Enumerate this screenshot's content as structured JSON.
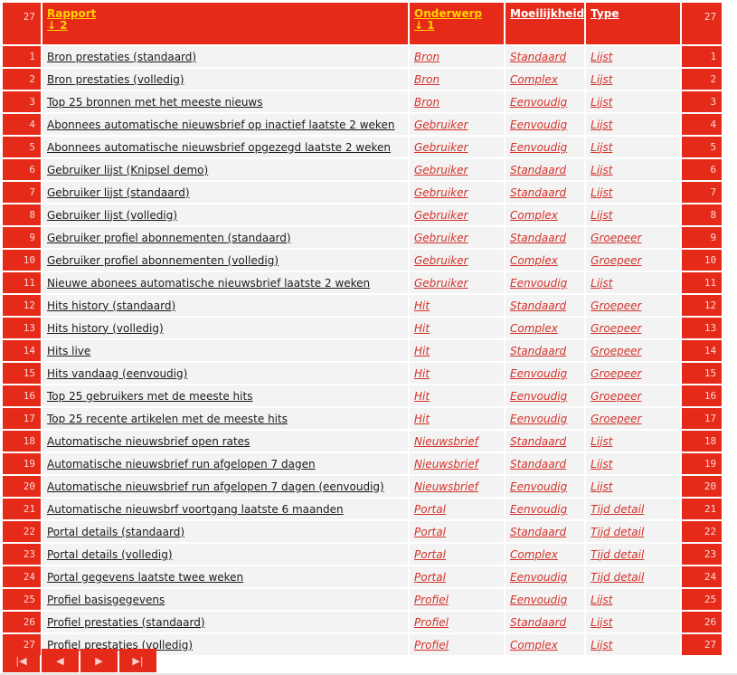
{
  "header": {
    "count_left": "27",
    "count_right": "27",
    "columns": {
      "rapport": {
        "label": "Rapport",
        "sort": "↓ 2"
      },
      "onderwerp": {
        "label": "Onderwerp",
        "sort": "↓ 1"
      },
      "moeilijkheid": {
        "label": "Moeilijkheid"
      },
      "type": {
        "label": "Type"
      }
    }
  },
  "colors": {
    "accent_red": "#e52a1a",
    "sorted_header_yellow": "#ffd200",
    "tag_link_red": "#d2322a",
    "row_bg": "#f3f3f3"
  },
  "rows": [
    {
      "n": "1",
      "rapport": "Bron prestaties (standaard)",
      "onderwerp": "Bron",
      "moeilijkheid": "Standaard",
      "type": "Lijst"
    },
    {
      "n": "2",
      "rapport": "Bron prestaties (volledig)",
      "onderwerp": "Bron",
      "moeilijkheid": "Complex",
      "type": "Lijst"
    },
    {
      "n": "3",
      "rapport": "Top 25 bronnen met het meeste nieuws",
      "onderwerp": "Bron",
      "moeilijkheid": "Eenvoudig",
      "type": "Lijst"
    },
    {
      "n": "4",
      "rapport": "Abonnees automatische nieuwsbrief op inactief laatste 2 weken",
      "onderwerp": "Gebruiker",
      "moeilijkheid": "Eenvoudig",
      "type": "Lijst"
    },
    {
      "n": "5",
      "rapport": "Abonnees automatische nieuwsbrief opgezegd laatste 2 weken",
      "onderwerp": "Gebruiker",
      "moeilijkheid": "Eenvoudig",
      "type": "Lijst"
    },
    {
      "n": "6",
      "rapport": "Gebruiker lijst (Knipsel demo)",
      "onderwerp": "Gebruiker",
      "moeilijkheid": "Standaard",
      "type": "Lijst"
    },
    {
      "n": "7",
      "rapport": "Gebruiker lijst (standaard)",
      "onderwerp": "Gebruiker",
      "moeilijkheid": "Standaard",
      "type": "Lijst"
    },
    {
      "n": "8",
      "rapport": "Gebruiker lijst (volledig)",
      "onderwerp": "Gebruiker",
      "moeilijkheid": "Complex",
      "type": "Lijst"
    },
    {
      "n": "9",
      "rapport": "Gebruiker profiel abonnementen (standaard)",
      "onderwerp": "Gebruiker",
      "moeilijkheid": "Standaard",
      "type": "Groepeer"
    },
    {
      "n": "10",
      "rapport": "Gebruiker profiel abonnementen (volledig)",
      "onderwerp": "Gebruiker",
      "moeilijkheid": "Complex",
      "type": "Groepeer"
    },
    {
      "n": "11",
      "rapport": "Nieuwe abonees automatische nieuwsbrief laatste 2 weken",
      "onderwerp": "Gebruiker",
      "moeilijkheid": "Eenvoudig",
      "type": "Lijst"
    },
    {
      "n": "12",
      "rapport": "Hits history (standaard)",
      "onderwerp": "Hit",
      "moeilijkheid": "Standaard",
      "type": "Groepeer"
    },
    {
      "n": "13",
      "rapport": "Hits history (volledig)",
      "onderwerp": "Hit",
      "moeilijkheid": "Complex",
      "type": "Groepeer"
    },
    {
      "n": "14",
      "rapport": "Hits live",
      "onderwerp": "Hit",
      "moeilijkheid": "Standaard",
      "type": "Groepeer"
    },
    {
      "n": "15",
      "rapport": "Hits vandaag (eenvoudig)",
      "onderwerp": "Hit",
      "moeilijkheid": "Eenvoudig",
      "type": "Groepeer"
    },
    {
      "n": "16",
      "rapport": "Top 25 gebruikers met de meeste hits",
      "onderwerp": "Hit",
      "moeilijkheid": "Eenvoudig",
      "type": "Groepeer"
    },
    {
      "n": "17",
      "rapport": "Top 25 recente artikelen met de meeste hits",
      "onderwerp": "Hit",
      "moeilijkheid": "Eenvoudig",
      "type": "Groepeer"
    },
    {
      "n": "18",
      "rapport": "Automatische nieuwsbrief open rates",
      "onderwerp": "Nieuwsbrief",
      "moeilijkheid": "Standaard",
      "type": "Lijst"
    },
    {
      "n": "19",
      "rapport": "Automatische nieuwsbrief run afgelopen 7 dagen",
      "onderwerp": "Nieuwsbrief",
      "moeilijkheid": "Standaard",
      "type": "Lijst"
    },
    {
      "n": "20",
      "rapport": "Automatische nieuwsbrief run afgelopen 7 dagen (eenvoudig)",
      "onderwerp": "Nieuwsbrief",
      "moeilijkheid": "Eenvoudig",
      "type": "Lijst"
    },
    {
      "n": "21",
      "rapport": "Automatische nieuwsbrf voortgang laatste 6 maanden",
      "onderwerp": "Portal",
      "moeilijkheid": "Eenvoudig",
      "type": "Tijd detail"
    },
    {
      "n": "22",
      "rapport": "Portal details (standaard)",
      "onderwerp": "Portal",
      "moeilijkheid": "Standaard",
      "type": "Tijd detail"
    },
    {
      "n": "23",
      "rapport": "Portal details (volledig)",
      "onderwerp": "Portal",
      "moeilijkheid": "Complex",
      "type": "Tijd detail"
    },
    {
      "n": "24",
      "rapport": "Portal gegevens laatste twee weken",
      "onderwerp": "Portal",
      "moeilijkheid": "Eenvoudig",
      "type": "Tijd detail"
    },
    {
      "n": "25",
      "rapport": "Profiel basisgegevens",
      "onderwerp": "Profiel",
      "moeilijkheid": "Eenvoudig",
      "type": "Lijst"
    },
    {
      "n": "26",
      "rapport": "Profiel prestaties (standaard)",
      "onderwerp": "Profiel",
      "moeilijkheid": "Standaard",
      "type": "Lijst"
    },
    {
      "n": "27",
      "rapport": "Profiel prestaties (volledig)",
      "onderwerp": "Profiel",
      "moeilijkheid": "Complex",
      "type": "Lijst"
    }
  ],
  "pager": {
    "first": {
      "icon": "first-page-icon",
      "glyph": "|◀"
    },
    "prev": {
      "icon": "previous-page-icon",
      "glyph": "◀"
    },
    "next": {
      "icon": "next-page-icon",
      "glyph": "▶"
    },
    "last": {
      "icon": "last-page-icon",
      "glyph": "▶|"
    }
  }
}
